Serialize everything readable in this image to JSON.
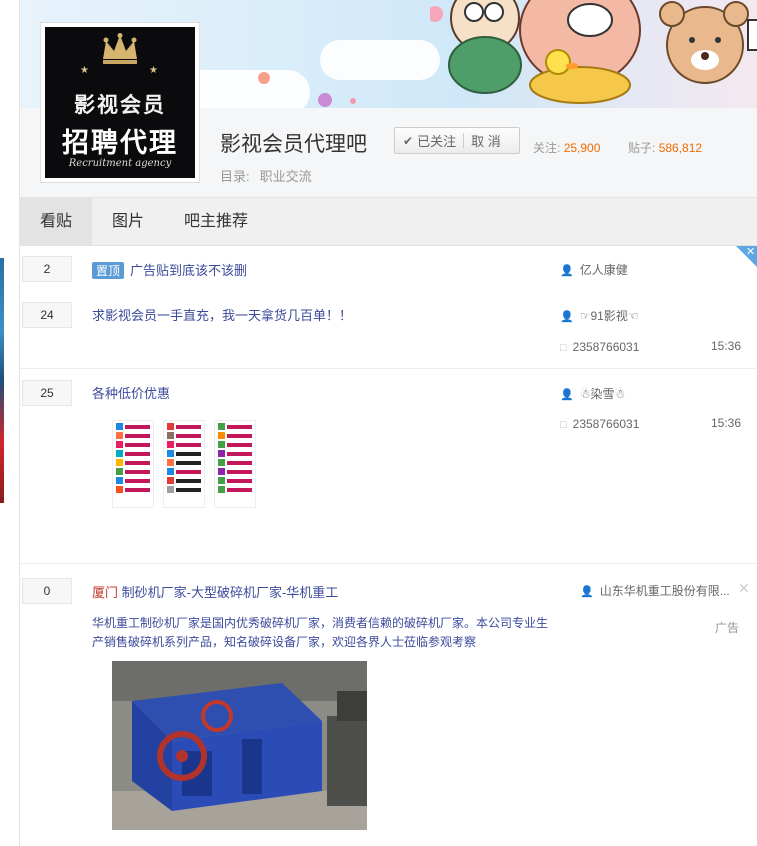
{
  "forum": {
    "name": "影视会员代理吧",
    "logo_line1": "影视会员",
    "logo_line2": "招聘代理",
    "logo_line3": "Recruitment agency",
    "follow_label": "已关注",
    "cancel_label": "取 消",
    "followers_label": "关注:",
    "followers_count": "25,900",
    "posts_label": "贴子:",
    "posts_count": "586,812",
    "catalog_label": "目录:",
    "catalog_value": "职业交流"
  },
  "tabs": [
    "看贴",
    "图片",
    "吧主推荐"
  ],
  "threads": [
    {
      "replies": "2",
      "badge": "置顶",
      "title": "广告贴到底该不该删",
      "author": "亿人康健"
    },
    {
      "replies": "24",
      "title": "求影视会员一手直充，我一天拿货几百单！！",
      "author": "☞91影视☜",
      "last_reply": "2358766031",
      "time": "15:36"
    },
    {
      "replies": "25",
      "title": "各种低价优惠",
      "author": "☃染雪☃",
      "last_reply": "2358766031",
      "time": "15:36"
    }
  ],
  "ad": {
    "replies": "0",
    "location": "厦门",
    "title": "制砂机厂家-大型破碎机厂家-华机重工",
    "author": "山东华机重工股份有限...",
    "label": "广告",
    "abstract_line1": "华机重工制砂机厂家是国内优秀破碎机厂家，消费者信赖的破碎机厂家。本公司专业生",
    "abstract_line2": "产销售破碎机系列产品，知名破碎设备厂家，欢迎各界人士莅临参观考察"
  },
  "colors": {
    "accent_orange": "#f06c00",
    "link_blue": "#3b4a9b",
    "badge_blue": "#5b9bd5"
  }
}
